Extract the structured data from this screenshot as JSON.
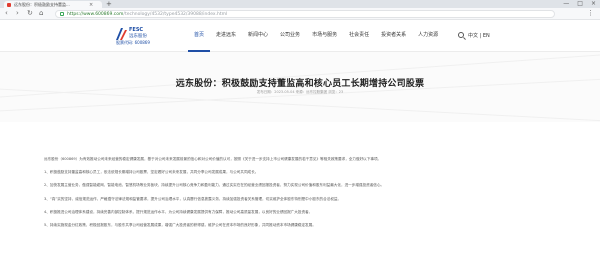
{
  "browser": {
    "tab_title": "远东股份：积极鼓励支持董监...",
    "tab_close": "×",
    "new_tab": "+",
    "window_buttons": [
      "—",
      "□",
      "×"
    ],
    "back": "‹",
    "forward": "›",
    "reload": "↻",
    "home": "⌂",
    "url_host": "https://www.600869.com",
    "url_path": "/technology/4532/type4532/39088/index.html",
    "menu": "⋮"
  },
  "site": {
    "logo_en": "FESC",
    "logo_cn": "远东股份",
    "logo_code": "股票代码: 600869",
    "nav": [
      "首页",
      "走进远东",
      "新闻中心",
      "公司业务",
      "市场与服务",
      "社会责任",
      "投资者关系",
      "人力资源"
    ],
    "lang": "中文 | EN"
  },
  "article": {
    "title": "远东股份：积极鼓励支持董监高和核心员工长期增持公司股票",
    "meta": "发布日期：2023-05-04   来源：远东控股集团   浏览：23",
    "paragraphs": [
      "远东股份（600869）为有效推动公司未来经营的稳定健康发展，基于对公司未来发展前景的信心和对公司价值的认可，按照《关于进一步支持上市公司健康发展的若干意见》等相关政策要求，全力做好以下事项。",
      "1、积极鼓励支持董监高和核心员工，依法依规长期增持公司股票，坚定看好公司未来发展，共同分享公司发展成果，与公司共同成长。",
      "2、加快发展主营业务，做强智能缆网、智能电池、智慧机场等业务板块，持续提升公司核心竞争力和盈利能力，通过实实在在的经营业绩回报投资者，努力实现公司价值和股东利益最大化，进一步增强投资者信心。",
      "3、“真”实的坚持，诚信规范运作，严格遵守法律法规和监管要求，提升公司治理水平，认真履行信息披露义务，持续加强投资者关系管理，切实维护全体股东特别是中小股东的合法权益。",
      "4、积极推进公司治理体系建设，持续完善内部控制体系，提升规范运作水平，为公司持续健康发展提供有力保障，推动公司高质量发展，以良好的业绩回报广大投资者。",
      "5、持续实施现金分红政策，积极回报股东，与股东共享公司经营发展成果，增强广大投资者的获得感，维护公司在资本市场的良好形象，共同推动资本市场健康稳定发展。"
    ]
  }
}
